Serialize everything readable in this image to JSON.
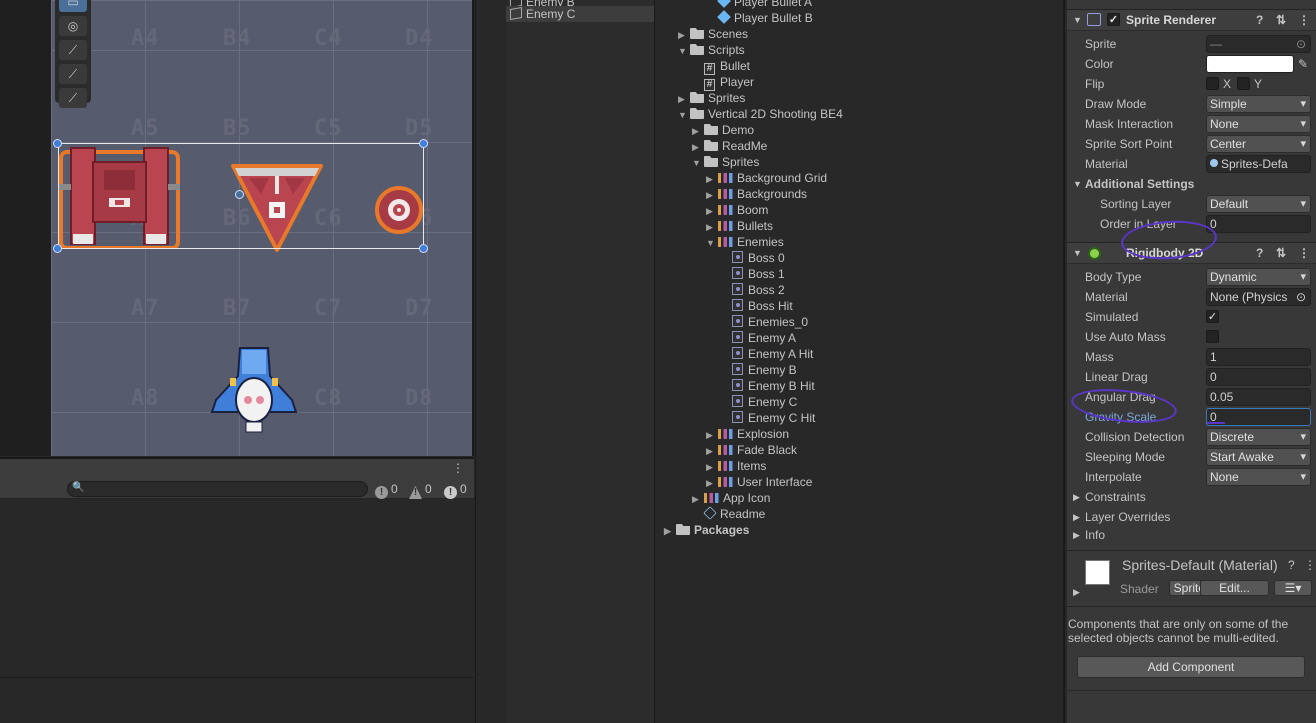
{
  "scene": {
    "cells": [
      {
        "label": "A4",
        "col": 0,
        "row": 0
      },
      {
        "label": "B4",
        "col": 1,
        "row": 0
      },
      {
        "label": "C4",
        "col": 2,
        "row": 0
      },
      {
        "label": "D4",
        "col": 3,
        "row": 0
      },
      {
        "label": "A5",
        "col": 0,
        "row": 1
      },
      {
        "label": "B5",
        "col": 1,
        "row": 1
      },
      {
        "label": "C5",
        "col": 2,
        "row": 1
      },
      {
        "label": "D5",
        "col": 3,
        "row": 1
      },
      {
        "label": "A6",
        "col": 0,
        "row": 2
      },
      {
        "label": "B6",
        "col": 1,
        "row": 2
      },
      {
        "label": "C6",
        "col": 2,
        "row": 2
      },
      {
        "label": "D6",
        "col": 3,
        "row": 2
      },
      {
        "label": "A7",
        "col": 0,
        "row": 3
      },
      {
        "label": "B7",
        "col": 1,
        "row": 3
      },
      {
        "label": "C7",
        "col": 2,
        "row": 3
      },
      {
        "label": "D7",
        "col": 3,
        "row": 3
      },
      {
        "label": "A8",
        "col": 0,
        "row": 4
      },
      {
        "label": "B8",
        "col": 1,
        "row": 4
      },
      {
        "label": "C8",
        "col": 2,
        "row": 4
      },
      {
        "label": "D8",
        "col": 3,
        "row": 4
      }
    ],
    "tools": [
      "rect-tool-icon",
      "transform-tool-icon",
      "bone-tool-icon",
      "bone-tool-icon",
      "bone-tool-icon"
    ]
  },
  "console": {
    "info_count": "0",
    "warning_count": "0",
    "error_count": "0"
  },
  "hierarchy": {
    "items": [
      "Enemy B",
      "Enemy C"
    ]
  },
  "project": {
    "items": [
      {
        "label": "Player Bullet A",
        "icon": "prefab",
        "depth": 3,
        "arrow": ""
      },
      {
        "label": "Player Bullet B",
        "icon": "prefab",
        "depth": 3,
        "arrow": ""
      },
      {
        "label": "Scenes",
        "icon": "folder",
        "depth": 1,
        "arrow": "▶"
      },
      {
        "label": "Scripts",
        "icon": "folder",
        "depth": 1,
        "arrow": "▼"
      },
      {
        "label": "Bullet",
        "icon": "script",
        "depth": 2,
        "arrow": ""
      },
      {
        "label": "Player",
        "icon": "script",
        "depth": 2,
        "arrow": ""
      },
      {
        "label": "Sprites",
        "icon": "folder",
        "depth": 1,
        "arrow": "▶"
      },
      {
        "label": "Vertical 2D Shooting BE4",
        "icon": "folder",
        "depth": 1,
        "arrow": "▼"
      },
      {
        "label": "Demo",
        "icon": "folder",
        "depth": 2,
        "arrow": "▶"
      },
      {
        "label": "ReadMe",
        "icon": "folder",
        "depth": 2,
        "arrow": "▶"
      },
      {
        "label": "Sprites",
        "icon": "folder",
        "depth": 2,
        "arrow": "▼"
      },
      {
        "label": "Background Grid",
        "icon": "sheet",
        "depth": 3,
        "arrow": "▶"
      },
      {
        "label": "Backgrounds",
        "icon": "sheet",
        "depth": 3,
        "arrow": "▶"
      },
      {
        "label": "Boom",
        "icon": "sheet",
        "depth": 3,
        "arrow": "▶"
      },
      {
        "label": "Bullets",
        "icon": "sheet",
        "depth": 3,
        "arrow": "▶"
      },
      {
        "label": "Enemies",
        "icon": "sheet",
        "depth": 3,
        "arrow": "▼"
      },
      {
        "label": "Boss 0",
        "icon": "sprite",
        "depth": 4,
        "arrow": ""
      },
      {
        "label": "Boss 1",
        "icon": "sprite",
        "depth": 4,
        "arrow": ""
      },
      {
        "label": "Boss 2",
        "icon": "sprite",
        "depth": 4,
        "arrow": ""
      },
      {
        "label": "Boss Hit",
        "icon": "sprite",
        "depth": 4,
        "arrow": ""
      },
      {
        "label": "Enemies_0",
        "icon": "sprite",
        "depth": 4,
        "arrow": ""
      },
      {
        "label": "Enemy A",
        "icon": "sprite",
        "depth": 4,
        "arrow": ""
      },
      {
        "label": "Enemy A Hit",
        "icon": "sprite",
        "depth": 4,
        "arrow": ""
      },
      {
        "label": "Enemy B",
        "icon": "sprite",
        "depth": 4,
        "arrow": ""
      },
      {
        "label": "Enemy B Hit",
        "icon": "sprite",
        "depth": 4,
        "arrow": ""
      },
      {
        "label": "Enemy C",
        "icon": "sprite",
        "depth": 4,
        "arrow": ""
      },
      {
        "label": "Enemy C Hit",
        "icon": "sprite",
        "depth": 4,
        "arrow": ""
      },
      {
        "label": "Explosion",
        "icon": "sheet",
        "depth": 3,
        "arrow": "▶"
      },
      {
        "label": "Fade Black",
        "icon": "sheet",
        "depth": 3,
        "arrow": "▶"
      },
      {
        "label": "Items",
        "icon": "sheet",
        "depth": 3,
        "arrow": "▶"
      },
      {
        "label": "User Interface",
        "icon": "sheet",
        "depth": 3,
        "arrow": "▶"
      },
      {
        "label": "App Icon",
        "icon": "sheet",
        "depth": 2,
        "arrow": "▶"
      },
      {
        "label": "Readme",
        "icon": "readme",
        "depth": 2,
        "arrow": ""
      },
      {
        "label": "Packages",
        "icon": "folder",
        "depth": 0,
        "arrow": "▶"
      }
    ]
  },
  "inspector": {
    "sprite_renderer": {
      "title": "Sprite Renderer",
      "sprite_label": "Sprite",
      "sprite_value": "—",
      "color_label": "Color",
      "color_value": "#ffffff",
      "flip_label": "Flip",
      "flip_x": "X",
      "flip_y": "Y",
      "draw_mode_label": "Draw Mode",
      "draw_mode_value": "Simple",
      "mask_label": "Mask Interaction",
      "mask_value": "None",
      "sort_point_label": "Sprite Sort Point",
      "sort_point_value": "Center",
      "material_label": "Material",
      "material_value": "Sprites-Defa",
      "additional_label": "Additional Settings",
      "sorting_layer_label": "Sorting Layer",
      "sorting_layer_value": "Default",
      "order_label": "Order in Layer",
      "order_value": "0"
    },
    "rigidbody": {
      "title": "Rigidbody 2D",
      "body_type_label": "Body Type",
      "body_type_value": "Dynamic",
      "material_label": "Material",
      "material_value": "None (Physics",
      "simulated_label": "Simulated",
      "simulated_checked": "✓",
      "auto_mass_label": "Use Auto Mass",
      "mass_label": "Mass",
      "mass_value": "1",
      "linear_drag_label": "Linear Drag",
      "linear_drag_value": "0",
      "angular_drag_label": "Angular Drag",
      "angular_drag_value": "0.05",
      "gravity_label": "Gravity Scale",
      "gravity_value": "0",
      "collision_label": "Collision Detection",
      "collision_value": "Discrete",
      "sleeping_label": "Sleeping Mode",
      "sleeping_value": "Start Awake",
      "interpolate_label": "Interpolate",
      "interpolate_value": "None",
      "constraints_label": "Constraints",
      "layer_overrides_label": "Layer Overrides",
      "info_label": "Info"
    },
    "material_block": {
      "name": "Sprites-Default (Material)",
      "shader_label": "Shader",
      "shader_value": "Sprite",
      "edit_label": "Edit..."
    },
    "multi_edit_note": "Components that are only on some of the selected objects cannot be multi-edited.",
    "add_component_label": "Add Component"
  },
  "colors": {
    "accent": "#3a79bb",
    "annotation": "#5a36c9",
    "selection_outline": "#e8792a",
    "enemy_red": "#b8454f"
  }
}
